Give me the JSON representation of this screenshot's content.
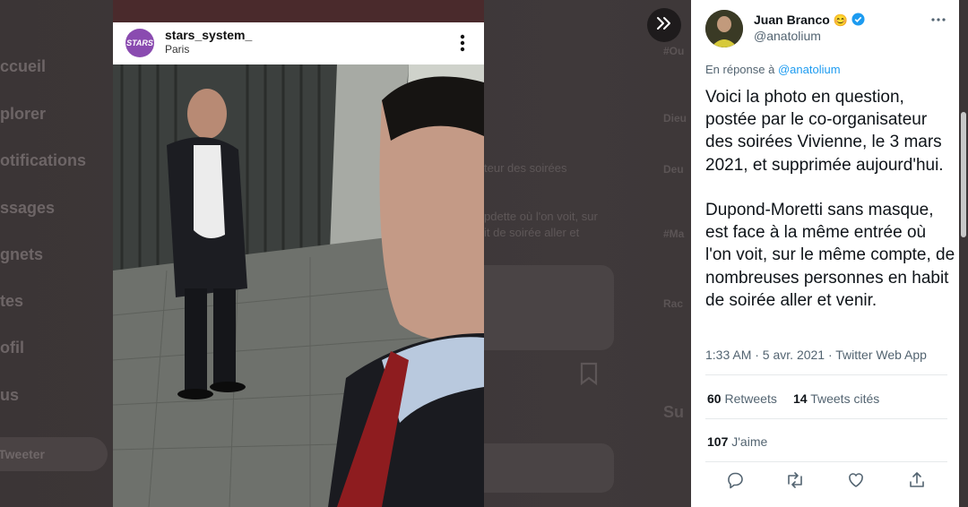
{
  "background_nav": {
    "items": [
      "ccueil",
      "plorer",
      "otifications",
      "ssages",
      "gnets",
      "tes",
      "ofil",
      "us"
    ],
    "tweet_button": "Tweeter"
  },
  "background_mid": {
    "lines": [
      "teur des soirées",
      "pdette où l'on voit, sur",
      "it de soirée aller et"
    ],
    "trends": [
      "#Ou",
      "Dieu",
      "Deu",
      "#Ma",
      "Rac"
    ],
    "trend_heading": "Su"
  },
  "instagram": {
    "avatar_text": "STARS",
    "username": "stars_system_",
    "location": "Paris",
    "more_icon": "vertical-dots-icon"
  },
  "tweet": {
    "display_name": "Juan Branco",
    "name_emoji": "😊",
    "handle": "@anatolium",
    "reply_prefix": "En réponse à",
    "reply_handle": "@anatolium",
    "text": "Voici la photo en question, postée par le co-organisateur des soirées Vivienne, le 3 mars 2021, et supprimée aujourd'hui.\n\nDupond-Moretti sans masque, est face à la même entrée où l'on voit, sur le même compte, de nombreuses personnes en habit de soirée aller et venir.",
    "meta": "1:33 AM · 5 avr. 2021 · Twitter Web App",
    "retweets_count": "60",
    "retweets_label": "Retweets",
    "quotes_count": "14",
    "quotes_label": "Tweets cités",
    "likes_count": "107",
    "likes_label": "J'aime",
    "colors": {
      "link": "#1d9bf0",
      "text": "#0f1419",
      "muted": "#536471"
    }
  },
  "icons": [
    "chevron-double-right-icon",
    "verified-badge-icon",
    "reply-icon",
    "retweet-icon",
    "like-icon",
    "share-icon",
    "bookmark-icon"
  ]
}
